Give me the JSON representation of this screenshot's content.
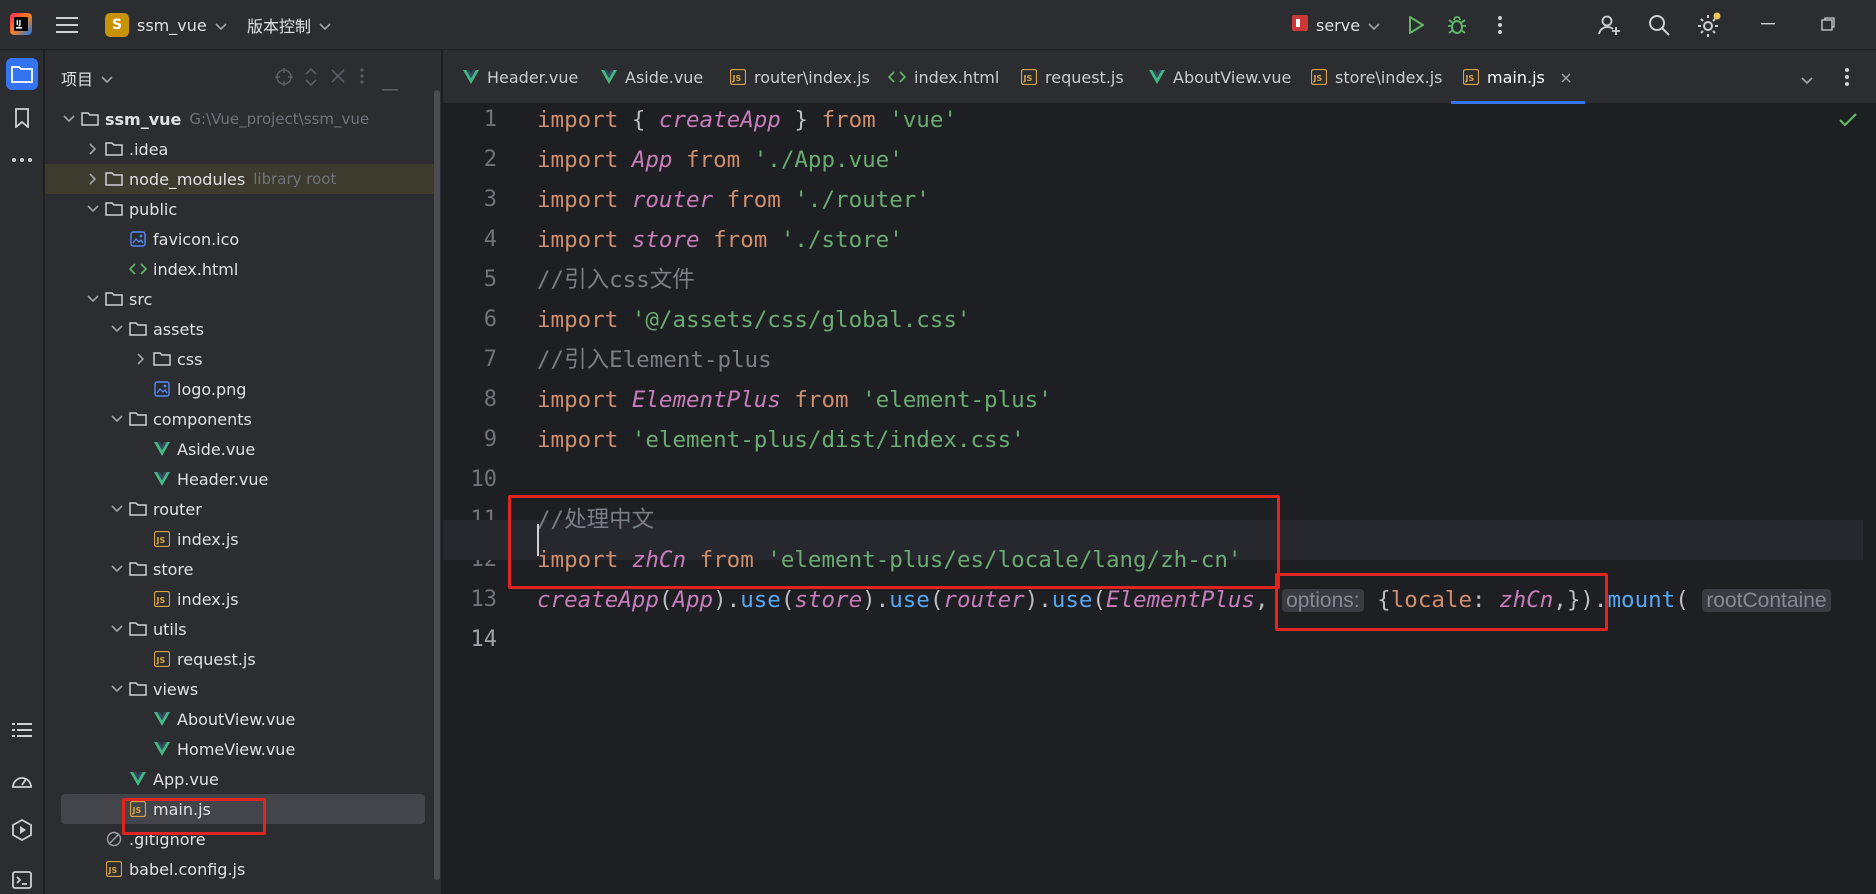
{
  "titlebar": {
    "project_badge": "S",
    "project_name": "ssm_vue",
    "vcs_label": "版本控制",
    "run_config": "serve"
  },
  "project_panel": {
    "title": "项目",
    "tree": [
      {
        "label": "ssm_vue",
        "sub": "G:\\Vue_project\\ssm_vue",
        "icon": "folder-icon",
        "chevron": "down"
      },
      {
        "label": ".idea",
        "icon": "folder-icon",
        "chevron": "right"
      },
      {
        "label": "node_modules",
        "sub": "library root",
        "icon": "folder-icon",
        "chevron": "right"
      },
      {
        "label": "public",
        "icon": "folder-icon",
        "chevron": "down"
      },
      {
        "label": "favicon.ico",
        "icon": "image-file-icon"
      },
      {
        "label": "index.html",
        "icon": "html-file-icon"
      },
      {
        "label": "src",
        "icon": "folder-icon",
        "chevron": "down"
      },
      {
        "label": "assets",
        "icon": "folder-icon",
        "chevron": "down"
      },
      {
        "label": "css",
        "icon": "folder-icon",
        "chevron": "right"
      },
      {
        "label": "logo.png",
        "icon": "image-file-icon"
      },
      {
        "label": "components",
        "icon": "folder-icon",
        "chevron": "down"
      },
      {
        "label": "Aside.vue",
        "icon": "vue-file-icon"
      },
      {
        "label": "Header.vue",
        "icon": "vue-file-icon"
      },
      {
        "label": "router",
        "icon": "folder-icon",
        "chevron": "down"
      },
      {
        "label": "index.js",
        "icon": "js-file-icon"
      },
      {
        "label": "store",
        "icon": "folder-icon",
        "chevron": "down"
      },
      {
        "label": "index.js",
        "icon": "js-file-icon"
      },
      {
        "label": "utils",
        "icon": "folder-icon",
        "chevron": "down"
      },
      {
        "label": "request.js",
        "icon": "js-file-icon"
      },
      {
        "label": "views",
        "icon": "folder-icon",
        "chevron": "down"
      },
      {
        "label": "AboutView.vue",
        "icon": "vue-file-icon"
      },
      {
        "label": "HomeView.vue",
        "icon": "vue-file-icon"
      },
      {
        "label": "App.vue",
        "icon": "vue-file-icon"
      },
      {
        "label": "main.js",
        "icon": "js-file-icon",
        "selected": true
      },
      {
        "label": ".gitignore",
        "icon": "ignore-file-icon"
      },
      {
        "label": "babel.config.js",
        "icon": "js-file-icon"
      }
    ]
  },
  "tabs": [
    {
      "label": "Header.vue",
      "icon": "vue-file-icon"
    },
    {
      "label": "Aside.vue",
      "icon": "vue-file-icon"
    },
    {
      "label": "router\\index.js",
      "icon": "js-file-icon"
    },
    {
      "label": "index.html",
      "icon": "html-file-icon"
    },
    {
      "label": "request.js",
      "icon": "js-file-icon"
    },
    {
      "label": "AboutView.vue",
      "icon": "vue-file-icon"
    },
    {
      "label": "store\\index.js",
      "icon": "js-file-icon"
    },
    {
      "label": "main.js",
      "icon": "js-file-icon",
      "active": true
    }
  ],
  "editor": {
    "line_numbers": [
      "1",
      "2",
      "3",
      "4",
      "5",
      "6",
      "7",
      "8",
      "9",
      "10",
      "11",
      "12",
      "13",
      "14"
    ],
    "lines": [
      [
        [
          "kw",
          "import"
        ],
        [
          "pl",
          " { "
        ],
        [
          "it",
          "createApp"
        ],
        [
          "pl",
          " } "
        ],
        [
          "kw",
          "from"
        ],
        [
          "pl",
          " "
        ],
        [
          "str",
          "'vue'"
        ]
      ],
      [
        [
          "kw",
          "import"
        ],
        [
          "pl",
          " "
        ],
        [
          "it",
          "App"
        ],
        [
          "pl",
          " "
        ],
        [
          "kw",
          "from"
        ],
        [
          "pl",
          " "
        ],
        [
          "str",
          "'./App.vue'"
        ]
      ],
      [
        [
          "kw",
          "import"
        ],
        [
          "pl",
          " "
        ],
        [
          "it",
          "router"
        ],
        [
          "pl",
          " "
        ],
        [
          "kw",
          "from"
        ],
        [
          "pl",
          " "
        ],
        [
          "str",
          "'./router'"
        ]
      ],
      [
        [
          "kw",
          "import"
        ],
        [
          "pl",
          " "
        ],
        [
          "it",
          "store"
        ],
        [
          "pl",
          " "
        ],
        [
          "kw",
          "from"
        ],
        [
          "pl",
          " "
        ],
        [
          "str",
          "'./store'"
        ]
      ],
      [
        [
          "cm",
          "//引入css文件"
        ]
      ],
      [
        [
          "kw",
          "import"
        ],
        [
          "pl",
          " "
        ],
        [
          "str",
          "'@/assets/css/global.css'"
        ]
      ],
      [
        [
          "cm",
          "//引入Element-plus"
        ]
      ],
      [
        [
          "kw",
          "import"
        ],
        [
          "pl",
          " "
        ],
        [
          "it",
          "ElementPlus"
        ],
        [
          "pl",
          " "
        ],
        [
          "kw",
          "from"
        ],
        [
          "pl",
          " "
        ],
        [
          "str",
          "'element-plus'"
        ]
      ],
      [
        [
          "kw",
          "import"
        ],
        [
          "pl",
          " "
        ],
        [
          "str",
          "'element-plus/dist/index.css'"
        ]
      ],
      [],
      [
        [
          "cm",
          "//处理中文"
        ]
      ],
      [
        [
          "kw",
          "import"
        ],
        [
          "pl",
          " "
        ],
        [
          "it",
          "zhCn"
        ],
        [
          "pl",
          " "
        ],
        [
          "kw",
          "from"
        ],
        [
          "pl",
          " "
        ],
        [
          "str",
          "'element-plus/es/locale/lang/zh-cn'"
        ]
      ],
      [
        [
          "it",
          "createApp"
        ],
        [
          "pl",
          "("
        ],
        [
          "it",
          "App"
        ],
        [
          "pl",
          ")."
        ],
        [
          "fn",
          "use"
        ],
        [
          "pl",
          "("
        ],
        [
          "it",
          "store"
        ],
        [
          "pl",
          ")."
        ],
        [
          "fn",
          "use"
        ],
        [
          "pl",
          "("
        ],
        [
          "it",
          "router"
        ],
        [
          "pl",
          ")."
        ],
        [
          "fn",
          "use"
        ],
        [
          "pl",
          "("
        ],
        [
          "it",
          "ElementPlus"
        ],
        [
          "pl",
          ", "
        ],
        [
          "hint",
          "options:"
        ],
        [
          "pl",
          " {"
        ],
        [
          "kw",
          "locale"
        ],
        [
          "pl",
          ": "
        ],
        [
          "it",
          "zhCn"
        ],
        [
          "pl",
          ",})."
        ],
        [
          "fn",
          "mount"
        ],
        [
          "pl",
          "( "
        ],
        [
          "hint",
          "rootContaine"
        ]
      ],
      []
    ]
  },
  "colors": {
    "annotation_red": "#e0251f",
    "accent_blue": "#3574f0"
  }
}
